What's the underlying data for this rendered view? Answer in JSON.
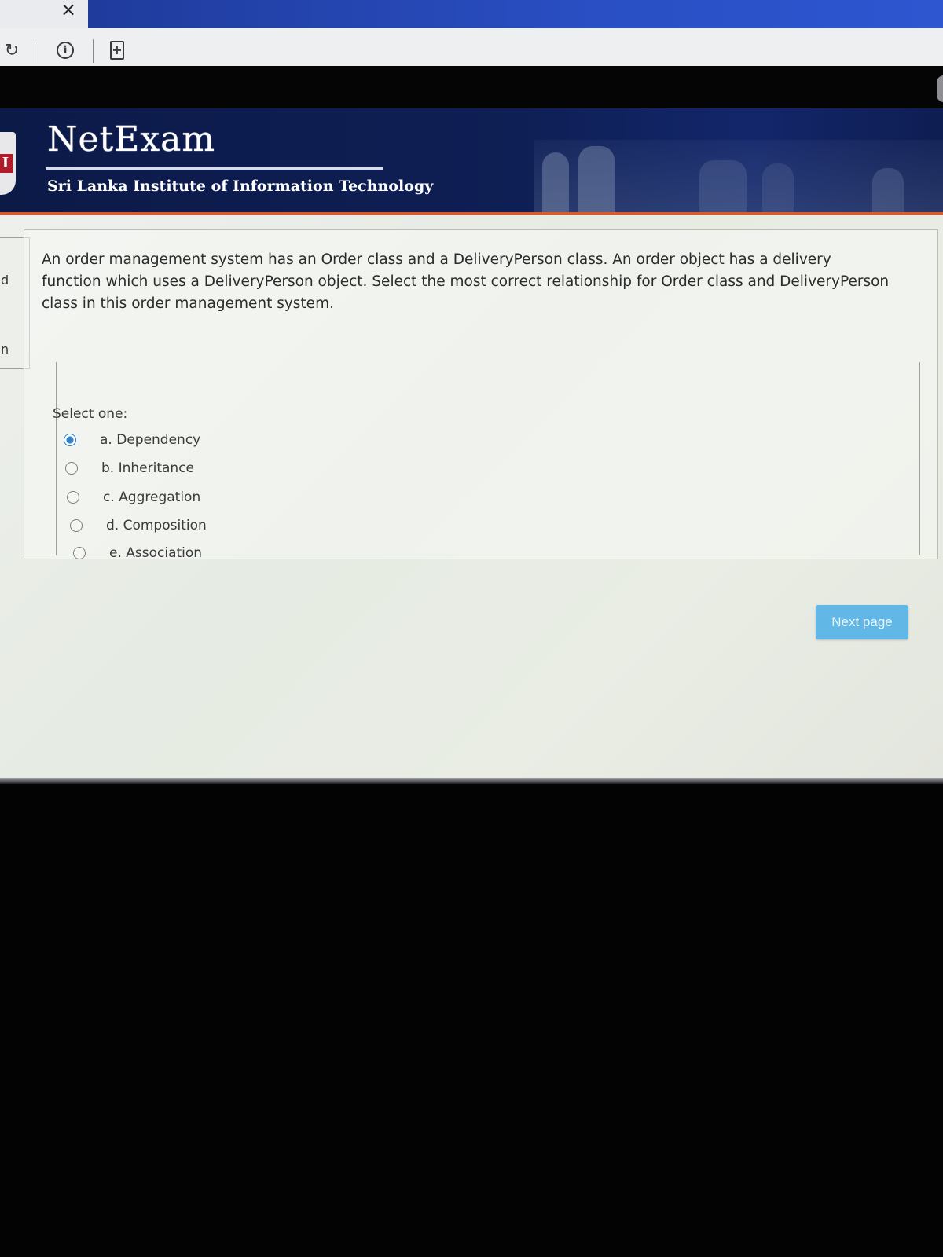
{
  "browser": {
    "tab_close_glyph": "×",
    "reload_glyph": "↻"
  },
  "header": {
    "brand": "NetExam",
    "institute": "Sri Lanka Institute of Information Technology"
  },
  "side_fragments": {
    "top": "d",
    "bottom": "n"
  },
  "question": {
    "text": "An order management system has an Order class and a DeliveryPerson class. An order object has a delivery function which uses a DeliveryPerson object. Select the most correct relationship for Order class and DeliveryPerson class in this order management system.",
    "prompt": "Select one:",
    "options": [
      {
        "label": "a. Dependency",
        "selected": true
      },
      {
        "label": "b. Inheritance",
        "selected": false
      },
      {
        "label": "c. Aggregation",
        "selected": false
      },
      {
        "label": "d. Composition",
        "selected": false
      },
      {
        "label": "e. Association",
        "selected": false
      }
    ]
  },
  "navigation": {
    "next_label": "Next page"
  },
  "colors": {
    "header_bg": "#0e1f55",
    "accent_line": "#d95a2b",
    "radio_selected": "#2f7fc9",
    "next_button": "#61b7e6"
  }
}
